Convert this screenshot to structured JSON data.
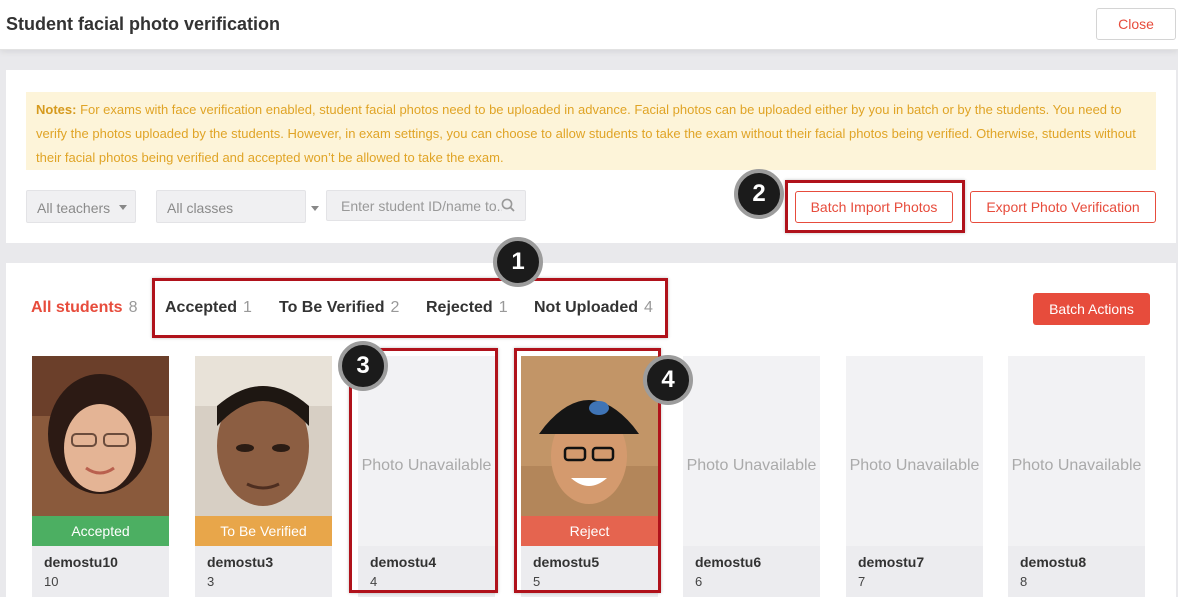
{
  "header": {
    "title": "Student facial photo verification",
    "close_label": "Close"
  },
  "notes": {
    "label": "Notes:",
    "text": " For exams with face verification enabled, student facial photos need to be uploaded in advance. Facial photos can be uploaded either by you in batch or by the students. You need to verify the photos uploaded by the students. However, in exam settings, you can choose to allow students to take the exam without their facial photos being verified. Otherwise, students without their facial photos being verified and accepted won’t be allowed to take the exam."
  },
  "filters": {
    "teachers": "All teachers",
    "classes": "All classes",
    "search_placeholder": "Enter student ID/name to..."
  },
  "actions": {
    "batch_import": "Batch Import Photos",
    "export": "Export Photo Verification",
    "batch_actions": "Batch Actions"
  },
  "tabs": [
    {
      "label": "All students",
      "count": "8"
    },
    {
      "label": "Accepted",
      "count": "1"
    },
    {
      "label": "To Be Verified",
      "count": "2"
    },
    {
      "label": "Rejected",
      "count": "1"
    },
    {
      "label": "Not Uploaded",
      "count": "4"
    }
  ],
  "students": [
    {
      "name": "demostu10",
      "id": "10",
      "status": "Accepted",
      "status_color": "#4caf62",
      "photo": "avatar-woman"
    },
    {
      "name": "demostu3",
      "id": "3",
      "status": "To Be Verified",
      "status_color": "#e8a64a",
      "photo": "avatar-man"
    },
    {
      "name": "demostu4",
      "id": "4",
      "unavailable": "Photo Unavailable"
    },
    {
      "name": "demostu5",
      "id": "5",
      "status": "Reject",
      "status_color": "#e5644f",
      "photo": "avatar-man-cap"
    },
    {
      "name": "demostu6",
      "id": "6",
      "unavailable": "Photo Unavailable"
    },
    {
      "name": "demostu7",
      "id": "7",
      "unavailable": "Photo Unavailable"
    },
    {
      "name": "demostu8",
      "id": "8",
      "unavailable": "Photo Unavailable"
    }
  ],
  "callouts": [
    "1",
    "2",
    "3",
    "4"
  ],
  "colors": {
    "accent": "#e74c3c",
    "highlight": "#b0121b",
    "notes_bg": "#fdf4d9",
    "notes_text": "#e0a426"
  }
}
